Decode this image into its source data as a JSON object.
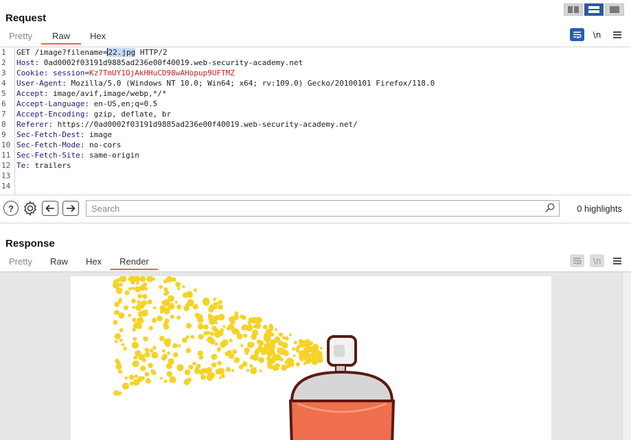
{
  "layout_buttons": [
    "side-by-side",
    "stacked",
    "single"
  ],
  "request": {
    "title": "Request",
    "tabs": [
      {
        "label": "Pretty",
        "state": "muted"
      },
      {
        "label": "Raw",
        "state": "active"
      },
      {
        "label": "Hex",
        "state": "normal"
      }
    ],
    "tools": {
      "newline_label": "\\n"
    },
    "lines": [
      {
        "n": "1",
        "parts": [
          [
            "hval",
            "GET /image?filename="
          ],
          [
            "cursor",
            ""
          ],
          [
            "sel",
            "22.jpg"
          ],
          [
            "hval",
            " HTTP/2"
          ]
        ]
      },
      {
        "n": "2",
        "parts": [
          [
            "hname",
            "Host: "
          ],
          [
            "hval",
            "0ad0002f03191d9885ad236e00f40019.web-security-academy.net"
          ]
        ]
      },
      {
        "n": "3",
        "parts": [
          [
            "hname",
            "Cookie: "
          ],
          [
            "hname",
            "session"
          ],
          [
            "hval",
            "="
          ],
          [
            "ck",
            "Kz7TmUY1OjAkHHuCD98wAHopup9UFTMZ"
          ]
        ]
      },
      {
        "n": "4",
        "parts": [
          [
            "hname",
            "User-Agent: "
          ],
          [
            "hval",
            "Mozilla/5.0 (Windows NT 10.0; Win64; x64; rv:109.0) Gecko/20100101 Firefox/118.0"
          ]
        ]
      },
      {
        "n": "5",
        "parts": [
          [
            "hname",
            "Accept: "
          ],
          [
            "hval",
            "image/avif,image/webp,*/*"
          ]
        ]
      },
      {
        "n": "6",
        "parts": [
          [
            "hname",
            "Accept-Language: "
          ],
          [
            "hval",
            "en-US,en;q=0.5"
          ]
        ]
      },
      {
        "n": "7",
        "parts": [
          [
            "hname",
            "Accept-Encoding: "
          ],
          [
            "hval",
            "gzip, deflate, br"
          ]
        ]
      },
      {
        "n": "8",
        "parts": [
          [
            "hname",
            "Referer: "
          ],
          [
            "hval",
            "https://0ad0002f03191d9885ad236e00f40019.web-security-academy.net/"
          ]
        ]
      },
      {
        "n": "9",
        "parts": [
          [
            "hname",
            "Sec-Fetch-Dest: "
          ],
          [
            "hval",
            "image"
          ]
        ]
      },
      {
        "n": "10",
        "parts": [
          [
            "hname",
            "Sec-Fetch-Mode: "
          ],
          [
            "hval",
            "no-cors"
          ]
        ]
      },
      {
        "n": "11",
        "parts": [
          [
            "hname",
            "Sec-Fetch-Site: "
          ],
          [
            "hval",
            "same-origin"
          ]
        ]
      },
      {
        "n": "12",
        "parts": [
          [
            "hname",
            "Te: "
          ],
          [
            "hval",
            "trailers"
          ]
        ]
      },
      {
        "n": "13",
        "parts": []
      },
      {
        "n": "14",
        "parts": []
      }
    ]
  },
  "search": {
    "placeholder": "Search",
    "highlights": "0 highlights"
  },
  "response": {
    "title": "Response",
    "tabs": [
      {
        "label": "Pretty",
        "state": "muted"
      },
      {
        "label": "Raw",
        "state": "normal"
      },
      {
        "label": "Hex",
        "state": "normal"
      },
      {
        "label": "Render",
        "state": "active"
      }
    ],
    "tools": {
      "newline_label": "\\n"
    },
    "render_image": "spray-paint-can-icon"
  },
  "colors": {
    "accent": "#e8673c",
    "active_button": "#2b5fa8",
    "spray": "#f5d327",
    "can_body": "#ef6f4e"
  }
}
